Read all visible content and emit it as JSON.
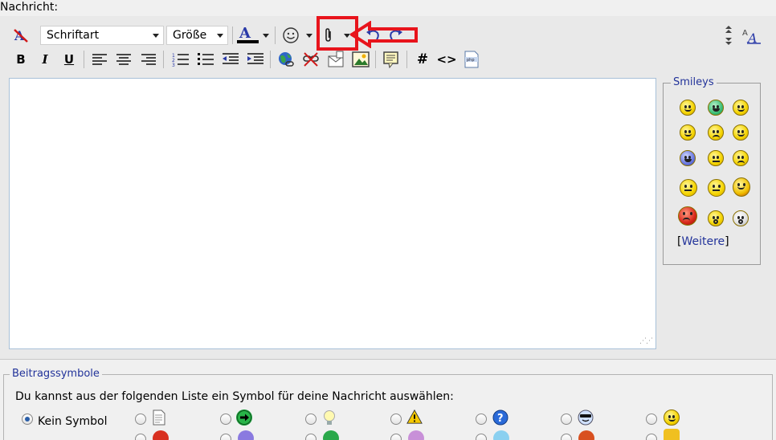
{
  "editor": {
    "label": "Nachricht:",
    "font_select": "Schriftart",
    "size_select": "Größe",
    "text_value": ""
  },
  "smileys": {
    "title": "Smileys",
    "more_open": "[",
    "more_link": "Weitere",
    "more_close": "]"
  },
  "post_icons": {
    "title": "Beitragssymbole",
    "description": "Du kannst aus der folgenden Liste ein Symbol für deine Nachricht auswählen:",
    "none_label": "Kein Symbol"
  },
  "colors": {
    "annotation": "#e8141c",
    "link": "#22339a"
  }
}
